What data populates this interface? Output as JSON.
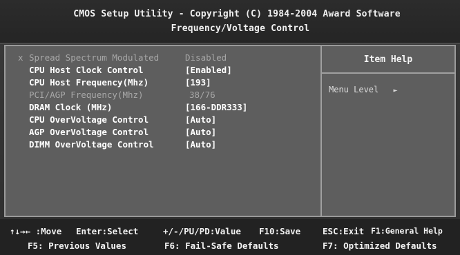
{
  "title": {
    "line1": "CMOS Setup Utility - Copyright (C) 1984-2004 Award Software",
    "line2": "Frequency/Voltage Control"
  },
  "settings": [
    {
      "label": "Spread Spectrum Modulated",
      "value": "Disabled",
      "state": "disabled",
      "marker": "x"
    },
    {
      "label": "CPU Host Clock Control",
      "value": "[Enabled]",
      "state": "enabled"
    },
    {
      "label": "CPU Host Frequency(Mhz)",
      "value": "[193]",
      "state": "enabled"
    },
    {
      "label": "PCI/AGP  Frequency(Mhz)",
      "value": "38/76",
      "state": "disabled"
    },
    {
      "label": "DRAM Clock (MHz)",
      "value": "[166-DDR333]",
      "state": "enabled"
    },
    {
      "label": "CPU  OverVoltage Control",
      "value": "[Auto]",
      "state": "enabled"
    },
    {
      "label": "AGP  OverVoltage Control",
      "value": "[Auto]",
      "state": "enabled"
    },
    {
      "label": "DIMM OverVoltage Control",
      "value": "[Auto]",
      "state": "enabled"
    }
  ],
  "help": {
    "header": "Item Help",
    "menu_level_label": "Menu Level",
    "menu_level_arrow": "►"
  },
  "footer": {
    "row1": [
      "↑↓→← :Move",
      "Enter:Select",
      "+/-/PU/PD:Value",
      "F10:Save",
      "ESC:Exit",
      "F1:General Help"
    ],
    "row2": [
      "F5: Previous Values",
      "F6: Fail-Safe Defaults",
      "F7: Optimized Defaults"
    ]
  }
}
